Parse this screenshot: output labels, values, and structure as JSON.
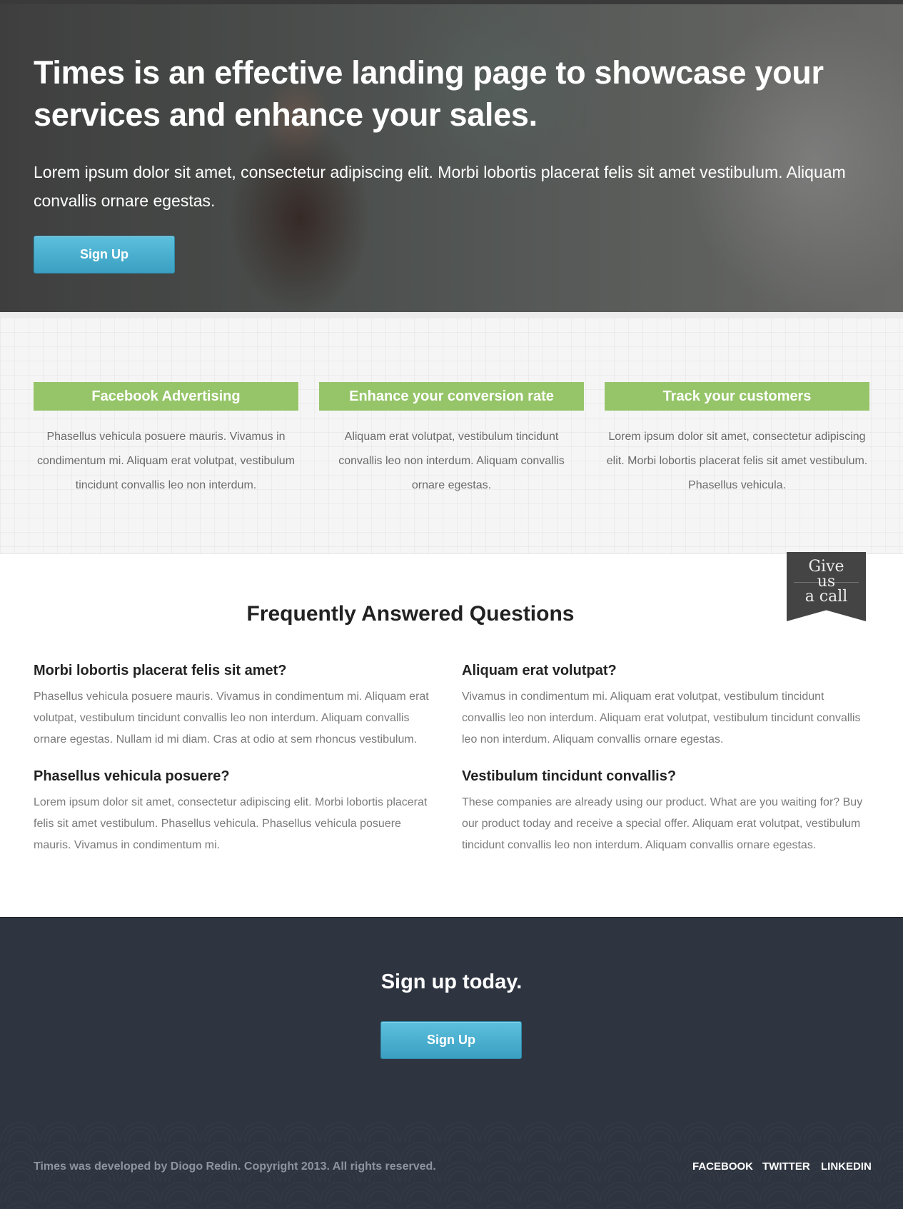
{
  "hero": {
    "title": "Times is an effective landing page to showcase your services and enhance your sales.",
    "text": "Lorem ipsum dolor sit amet, consectetur adipiscing elit. Morbi lobortis placerat felis sit amet vestibulum. Aliquam convallis ornare egestas.",
    "button_label": "Sign Up"
  },
  "features": [
    {
      "title": "Facebook Advertising",
      "text": "Phasellus vehicula posuere mauris. Vivamus in condimentum mi. Aliquam erat volutpat, vestibulum tincidunt convallis leo non interdum."
    },
    {
      "title": "Enhance your conversion rate",
      "text": "Aliquam erat volutpat, vestibulum tincidunt convallis leo non interdum. Aliquam convallis ornare egestas."
    },
    {
      "title": "Track your customers",
      "text": "Lorem ipsum dolor sit amet, consectetur adipiscing elit. Morbi lobortis placerat felis sit amet vestibulum. Phasellus vehicula."
    }
  ],
  "ribbon": {
    "line1": "Give",
    "line2": "us",
    "line3": "a call"
  },
  "faq": {
    "title": "Frequently Answered Questions",
    "items": [
      {
        "q": "Morbi lobortis placerat felis sit amet?",
        "a": "Phasellus vehicula posuere mauris. Vivamus in condimentum mi. Aliquam erat volutpat, vestibulum tincidunt convallis leo non interdum. Aliquam convallis ornare egestas. Nullam id mi diam. Cras at odio at sem rhoncus vestibulum."
      },
      {
        "q": "Aliquam erat volutpat?",
        "a": "Vivamus in condimentum mi. Aliquam erat volutpat, vestibulum tincidunt convallis leo non interdum. Aliquam erat volutpat, vestibulum tincidunt convallis leo non interdum. Aliquam convallis ornare egestas."
      },
      {
        "q": "Phasellus vehicula posuere?",
        "a": "Lorem ipsum dolor sit amet, consectetur adipiscing elit. Morbi lobortis placerat felis sit amet vestibulum. Phasellus vehicula. Phasellus vehicula posuere mauris. Vivamus in condimentum mi."
      },
      {
        "q": "Vestibulum tincidunt convallis?",
        "a": "These companies are already using our product. What are you waiting for? Buy our product today and receive a special offer. Aliquam erat volutpat, vestibulum tincidunt convallis leo non interdum. Aliquam convallis ornare egestas."
      }
    ]
  },
  "signup": {
    "title": "Sign up today.",
    "button_label": "Sign Up"
  },
  "footer": {
    "copyright": "Times was developed by Diogo Redin. Copyright 2013. All rights reserved.",
    "links": [
      "FACEBOOK",
      "TWITTER",
      "LINKEDIN"
    ]
  },
  "colors": {
    "accent_green": "#96c569",
    "button_blue": "#4fb3d5",
    "dark_bg": "#2f3540"
  }
}
